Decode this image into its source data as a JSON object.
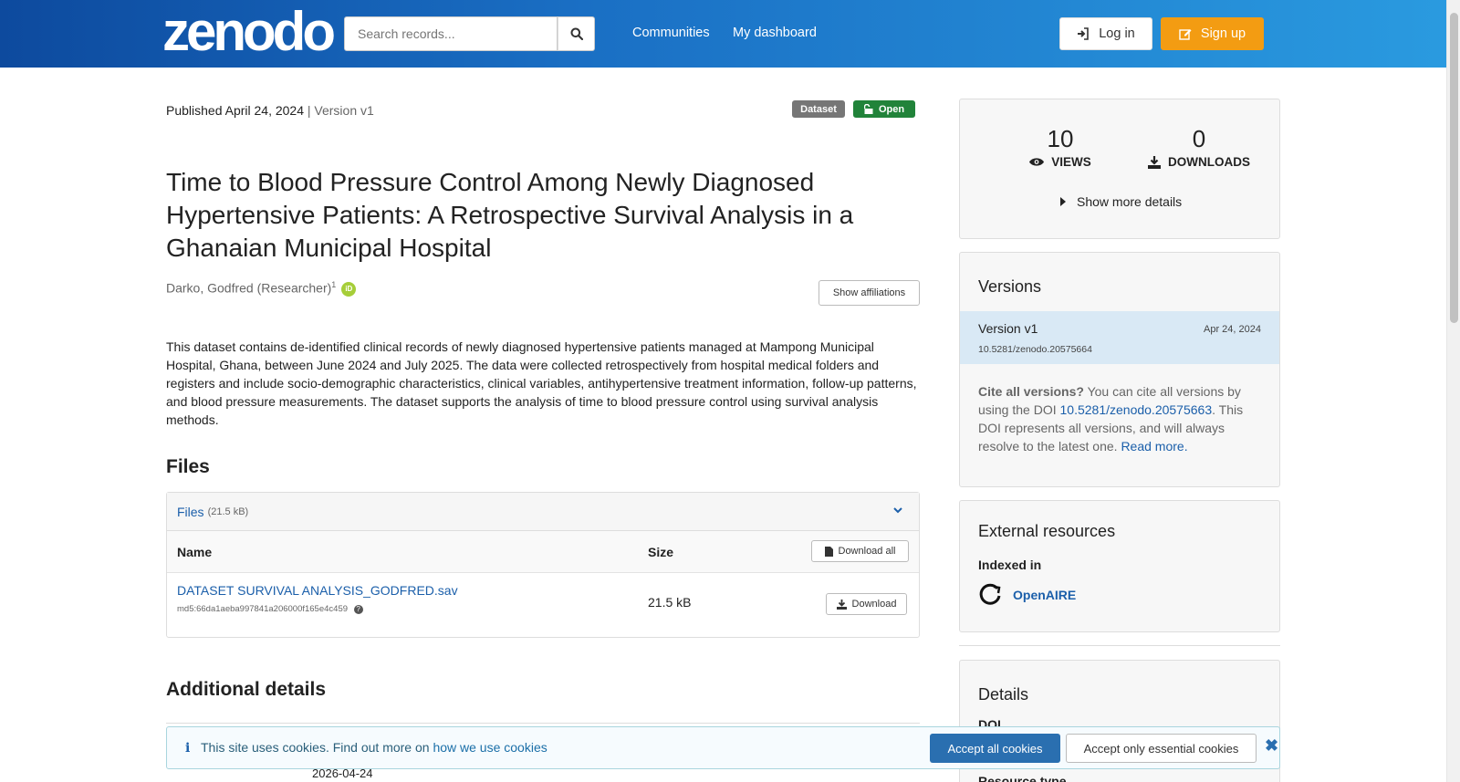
{
  "header": {
    "logo": "zenodo",
    "search_placeholder": "Search records...",
    "nav": [
      "Communities",
      "My dashboard"
    ],
    "login_label": "Log in",
    "signup_label": "Sign up"
  },
  "record": {
    "published": "Published April 24, 2024",
    "version": "| Version v1",
    "badge_type": "Dataset",
    "badge_access": "Open",
    "title": "Time to Blood Pressure Control Among Newly Diagnosed Hypertensive Patients: A Retrospective Survival Analysis in a Ghanaian Municipal Hospital",
    "author": "Darko, Godfred (Researcher)",
    "author_sup": "1",
    "show_affiliations": "Show affiliations",
    "description": "This dataset contains de-identified clinical records of newly diagnosed hypertensive patients managed at Mampong Municipal Hospital, Ghana, between June 2024 and July 2025. The data were collected retrospectively from hospital medical folders and registers and include socio-demographic characteristics, clinical variables, antihypertensive treatment information, follow-up patterns, and blood pressure measurements. The dataset supports the analysis of time to blood pressure control using survival analysis methods."
  },
  "files": {
    "heading": "Files",
    "bar_label": "Files",
    "bar_size": "(21.5 kB)",
    "col_name": "Name",
    "col_size": "Size",
    "download_all": "Download all",
    "items": [
      {
        "name": "DATASET SURVIVAL ANALYSIS_GODFRED.sav",
        "md5": "md5:66da1aeba997841a206000f165e4c459",
        "size": "21.5 kB",
        "download": "Download"
      }
    ]
  },
  "additional": {
    "heading": "Additional details",
    "date": "2026-04-24"
  },
  "sidebar": {
    "views_count": "10",
    "views_label": "VIEWS",
    "downloads_count": "0",
    "downloads_label": "DOWNLOADS",
    "more_details": "Show more details",
    "versions_title": "Versions",
    "version_name": "Version v1",
    "version_date": "Apr 24, 2024",
    "version_doi": "10.5281/zenodo.20575664",
    "cite_bold": "Cite all versions?",
    "cite_text1": " You can cite all versions by using the DOI ",
    "cite_doi": "10.5281/zenodo.20575663",
    "cite_text2": ". This DOI represents all versions, and will always resolve to the latest one. ",
    "cite_read_more": "Read more.",
    "external_title": "External resources",
    "indexed_in": "Indexed in",
    "openaire": "OpenAIRE",
    "details_title": "Details",
    "doi_label": "DOI",
    "resource_type_label": "Resource type"
  },
  "cookie": {
    "text": "This site uses cookies. Find out more on ",
    "link": "how we use cookies",
    "accept_all": "Accept all cookies",
    "accept_essential": "Accept only essential cookies"
  }
}
